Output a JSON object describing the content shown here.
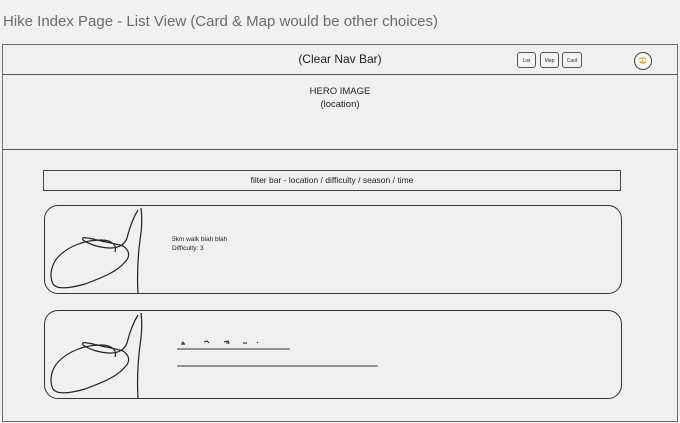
{
  "page": {
    "title": "Hike Index Page - List View (Card & Map would be other choices)"
  },
  "navbar": {
    "title": "(Clear Nav Bar)",
    "view_buttons": [
      {
        "label": "List"
      },
      {
        "label": "Map"
      },
      {
        "label": "Card"
      }
    ],
    "avatar_icon": "smiley-icon"
  },
  "hero": {
    "title": "HERO IMAGE",
    "subtitle": "(location)"
  },
  "filter_bar": {
    "label": "filter bar - location / difficulty / season / time"
  },
  "hike_list": [
    {
      "image_icon": "image-placeholder-scribble",
      "description": "5km walk blah blah",
      "difficulty": "Difficulty: 3"
    },
    {
      "image_icon": "image-placeholder-scribble",
      "description": "",
      "difficulty": ""
    }
  ]
}
